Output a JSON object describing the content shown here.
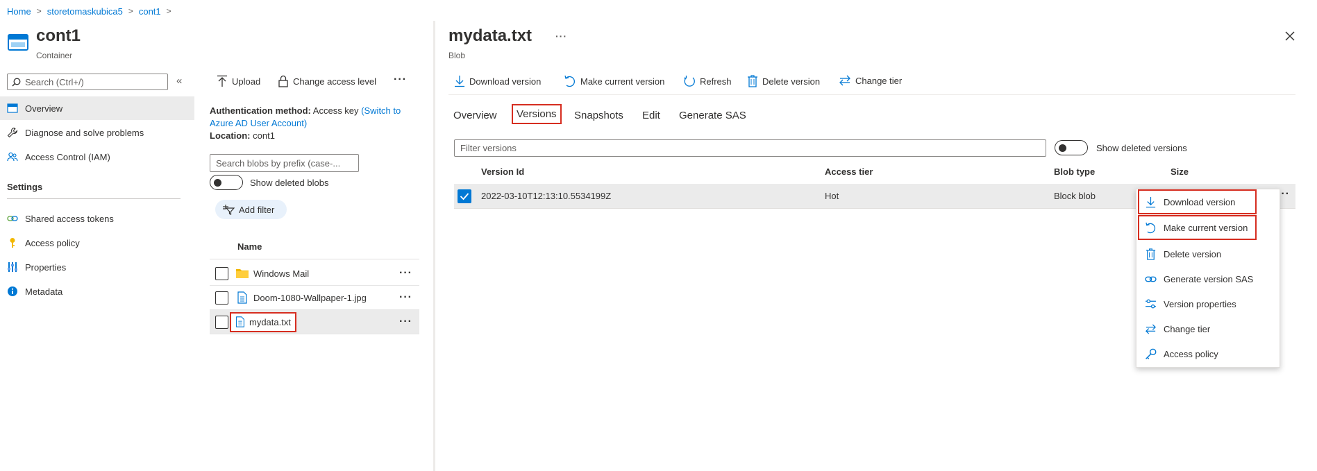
{
  "breadcrumb": {
    "items": [
      "Home",
      "storetomaskubica5",
      "cont1"
    ]
  },
  "container": {
    "title": "cont1",
    "subtitle": "Container"
  },
  "left_nav": {
    "search_placeholder": "Search (Ctrl+/)",
    "items": [
      {
        "label": "Overview",
        "icon": "overview-icon"
      },
      {
        "label": "Diagnose and solve problems",
        "icon": "wrench-icon"
      },
      {
        "label": "Access Control (IAM)",
        "icon": "people-icon"
      }
    ],
    "settings_header": "Settings",
    "settings_items": [
      {
        "label": "Shared access tokens",
        "icon": "link-icon"
      },
      {
        "label": "Access policy",
        "icon": "key-icon"
      },
      {
        "label": "Properties",
        "icon": "sliders-icon"
      },
      {
        "label": "Metadata",
        "icon": "info-icon"
      }
    ]
  },
  "middle": {
    "toolbar": {
      "upload": "Upload",
      "change_access": "Change access level"
    },
    "auth_label": "Authentication method:",
    "auth_value": "Access key",
    "auth_link": "(Switch to Azure AD User Account)",
    "location_label": "Location:",
    "location_value": "cont1",
    "search_placeholder": "Search blobs by prefix (case-...",
    "show_deleted": "Show deleted blobs",
    "add_filter": "Add filter",
    "col_name": "Name",
    "files": [
      {
        "name": "Windows Mail",
        "type": "folder"
      },
      {
        "name": "Doom-1080-Wallpaper-1.jpg",
        "type": "file"
      },
      {
        "name": "mydata.txt",
        "type": "file"
      }
    ]
  },
  "blob": {
    "title": "mydata.txt",
    "subtitle": "Blob",
    "toolbar": {
      "download": "Download version",
      "make_current": "Make current version",
      "refresh": "Refresh",
      "delete": "Delete version",
      "change_tier": "Change tier"
    },
    "tabs": [
      "Overview",
      "Versions",
      "Snapshots",
      "Edit",
      "Generate SAS"
    ],
    "active_tab": "Versions",
    "filter_placeholder": "Filter versions",
    "show_deleted_versions": "Show deleted versions",
    "columns": [
      "Version Id",
      "Access tier",
      "Blob type",
      "Size"
    ],
    "rows": [
      {
        "version_id": "2022-03-10T12:13:10.5534199Z",
        "access_tier": "Hot",
        "blob_type": "Block blob",
        "size": ""
      }
    ],
    "context_menu": [
      {
        "label": "Download version",
        "icon": "download-icon"
      },
      {
        "label": "Make current version",
        "icon": "restore-icon"
      },
      {
        "label": "Delete version",
        "icon": "trash-icon"
      },
      {
        "label": "Generate version SAS",
        "icon": "link-icon"
      },
      {
        "label": "Version properties",
        "icon": "sliders-icon"
      },
      {
        "label": "Change tier",
        "icon": "swap-icon"
      },
      {
        "label": "Access policy",
        "icon": "key-icon"
      }
    ]
  },
  "colors": {
    "accent": "#0078d4",
    "highlight_border": "#d62d20",
    "selected_row": "#ebebeb"
  }
}
